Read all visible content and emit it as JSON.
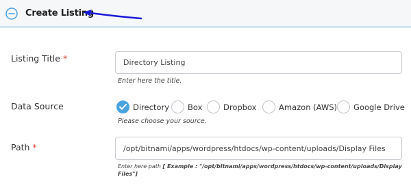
{
  "header": {
    "title": "Create Listing",
    "accent_color": "#4aa3df",
    "annotation_arrow_color": "#1a1ad6",
    "collapse_icon": "minus-circle-icon"
  },
  "fields": {
    "listing_title": {
      "label": "Listing Title",
      "required_mark": "*",
      "value": "Directory Listing",
      "help": "Enter here the title."
    },
    "data_source": {
      "label": "Data Source",
      "options": [
        "Directory",
        "Box",
        "Dropbox",
        "Amazon (AWS)",
        "Google Drive"
      ],
      "selected": "Directory",
      "help": "Please choose your source."
    },
    "path": {
      "label": "Path",
      "required_mark": "*",
      "value": "/opt/bitnami/apps/wordpress/htdocs/wp-content/uploads/Display Files",
      "help_prefix": "Enter here path ",
      "help_example": "[ Example : \"/opt/bitnami/apps/wordpress/htdocs/wp-content/uploads/Display Files\"]"
    }
  }
}
